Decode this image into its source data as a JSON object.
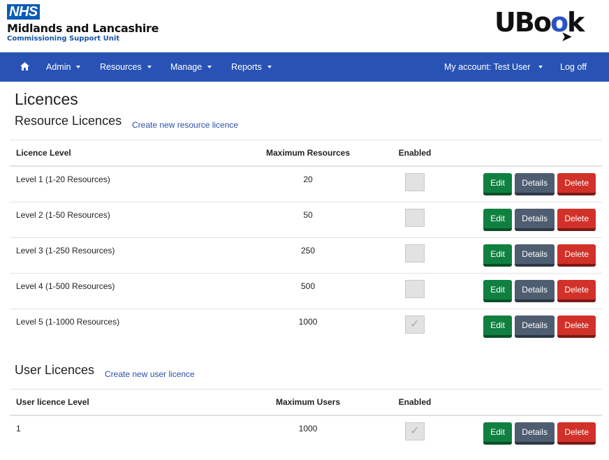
{
  "header": {
    "nhs_badge": "NHS",
    "org_name": "Midlands and Lancashire",
    "org_sub": "Commissioning Support Unit",
    "app_logo": {
      "part1": "UBo",
      "part2": "o",
      "part3": "k"
    }
  },
  "nav": {
    "home_icon": "home-icon",
    "items": [
      {
        "label": "Admin",
        "has_dropdown": true
      },
      {
        "label": "Resources",
        "has_dropdown": true
      },
      {
        "label": "Manage",
        "has_dropdown": true
      },
      {
        "label": "Reports",
        "has_dropdown": true
      }
    ],
    "account": {
      "label": "My account: Test User",
      "has_dropdown": true
    },
    "logoff": "Log off",
    "color": "#2853b5"
  },
  "page": {
    "title": "Licences"
  },
  "resource_licences": {
    "title": "Resource Licences",
    "create_link": "Create new resource licence",
    "columns": [
      "Licence Level",
      "Maximum Resources",
      "Enabled",
      ""
    ],
    "rows": [
      {
        "level": "Level 1 (1-20 Resources)",
        "max": "20",
        "enabled": false
      },
      {
        "level": "Level 2 (1-50 Resources)",
        "max": "50",
        "enabled": false
      },
      {
        "level": "Level 3 (1-250 Resources)",
        "max": "250",
        "enabled": false
      },
      {
        "level": "Level 4 (1-500 Resources)",
        "max": "500",
        "enabled": false
      },
      {
        "level": "Level 5 (1-1000 Resources)",
        "max": "1000",
        "enabled": true
      }
    ]
  },
  "user_licences": {
    "title": "User Licences",
    "create_link": "Create new user licence",
    "columns": [
      "User licence Level",
      "Maximum Users",
      "Enabled",
      ""
    ],
    "rows": [
      {
        "level": "1",
        "max": "1000",
        "enabled": true
      }
    ]
  },
  "actions": {
    "edit": "Edit",
    "details": "Details",
    "delete": "Delete",
    "colors": {
      "edit": "#108040",
      "details": "#4e5d70",
      "delete": "#d13128"
    }
  },
  "checkmark": "✓"
}
